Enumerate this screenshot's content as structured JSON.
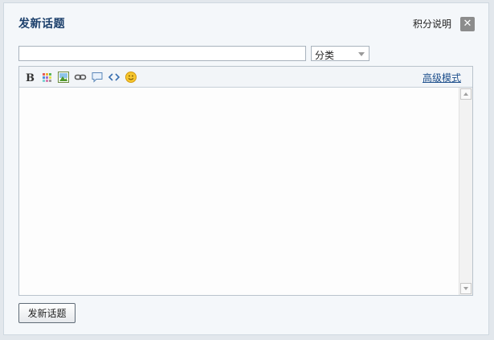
{
  "dialog": {
    "title": "发新话题",
    "help_link": "积分说明",
    "close_icon": "close-icon"
  },
  "form": {
    "subject_value": "",
    "subject_placeholder": "",
    "category_selected": "分类"
  },
  "editor": {
    "toolbar": [
      {
        "name": "bold-icon",
        "label": "B"
      },
      {
        "name": "color-grid-icon"
      },
      {
        "name": "image-icon"
      },
      {
        "name": "link-icon"
      },
      {
        "name": "quote-bubble-icon"
      },
      {
        "name": "code-icon",
        "label": "<>"
      },
      {
        "name": "smiley-icon"
      }
    ],
    "advanced_mode": "高级模式",
    "content": ""
  },
  "footer": {
    "submit_label": "发新话题"
  },
  "colors": {
    "title": "#1b3f6b",
    "link": "#1d4f8c",
    "close_bg": "#8c8c8c",
    "modal_bg": "#f4f7fa"
  }
}
